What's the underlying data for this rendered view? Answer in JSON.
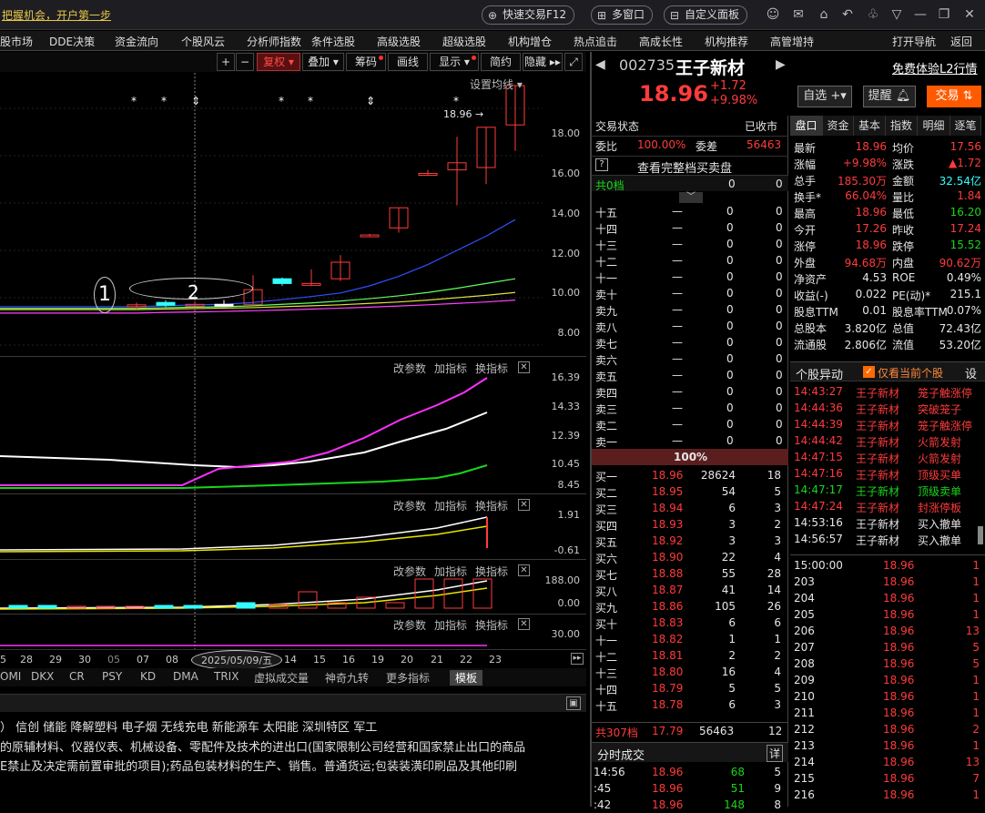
{
  "title": "把握机会，开户第一步",
  "top_buttons": [
    {
      "label": "快速交易F12",
      "icon": "quick-trade-icon"
    },
    {
      "label": "多窗口",
      "icon": "multi-window-icon"
    },
    {
      "label": "自定义面板",
      "icon": "custom-panel-icon"
    }
  ],
  "menu": [
    "股市场",
    "DDE决策",
    "资金流向",
    "个股风云",
    "分析师指数",
    "条件选股",
    "高级选股",
    "超级选股",
    "机构增仓",
    "热点追击",
    "高成长性",
    "机构推荐",
    "高管增持",
    "打开导航",
    "返回"
  ],
  "chart_toolbar": [
    "+",
    "−",
    "复权",
    "叠加",
    "筹码",
    "画线",
    "显示",
    "简约",
    "隐藏"
  ],
  "chart": {
    "setting_label": "设置均线",
    "last_price_label": "18.96",
    "y_labels": [
      "18.00",
      "16.00",
      "14.00",
      "12.00",
      "10.00",
      "8.00"
    ],
    "annotation_1": "1",
    "annotation_2": "2",
    "star_marks": [
      "*",
      "*",
      "*",
      "*",
      "*"
    ],
    "arrow_marks": [
      "⇕",
      "⇕"
    ]
  },
  "chart_data": {
    "type": "candlestick",
    "y_range": [
      7.5,
      19.5
    ],
    "candles": [
      {
        "o": 9.62,
        "c": 9.7,
        "h": 9.8,
        "l": 9.5,
        "color": "red"
      },
      {
        "o": 9.8,
        "c": 9.68,
        "h": 9.9,
        "l": 9.6,
        "color": "cyan"
      },
      {
        "o": 9.7,
        "c": 9.72,
        "h": 9.85,
        "l": 9.62,
        "color": "red"
      },
      {
        "o": 9.72,
        "c": 9.72,
        "h": 9.9,
        "l": 9.6,
        "color": "white"
      },
      {
        "o": 9.72,
        "c": 10.34,
        "h": 10.95,
        "l": 9.72,
        "color": "red"
      },
      {
        "o": 10.8,
        "c": 10.6,
        "h": 10.85,
        "l": 10.5,
        "color": "cyan"
      },
      {
        "o": 10.55,
        "c": 10.6,
        "h": 11.2,
        "l": 10.5,
        "color": "red"
      },
      {
        "o": 10.8,
        "c": 11.5,
        "h": 11.8,
        "l": 10.7,
        "color": "red"
      },
      {
        "o": 12.6,
        "c": 12.65,
        "h": 12.7,
        "l": 12.6,
        "color": "red"
      },
      {
        "o": 12.95,
        "c": 13.8,
        "h": 13.8,
        "l": 12.75,
        "color": "red"
      },
      {
        "o": 15.2,
        "c": 15.25,
        "h": 15.4,
        "l": 15.15,
        "color": "red"
      },
      {
        "o": 15.4,
        "c": 15.7,
        "h": 16.8,
        "l": 13.9,
        "color": "red"
      },
      {
        "o": 15.5,
        "c": 17.2,
        "h": 17.2,
        "l": 14.8,
        "color": "red"
      },
      {
        "o": 17.3,
        "c": 18.96,
        "h": 18.96,
        "l": 16.2,
        "color": "red"
      }
    ],
    "ma_lines": [
      {
        "name": "MA5",
        "color": "#3050ff",
        "values": [
          9.62,
          9.66,
          9.7,
          9.72,
          9.8,
          9.92,
          10.05,
          10.2,
          10.5,
          10.9,
          11.4,
          12.0,
          12.6,
          13.3
        ]
      },
      {
        "name": "MA10",
        "color": "#60ff60",
        "values": [
          9.55,
          9.58,
          9.6,
          9.62,
          9.66,
          9.72,
          9.78,
          9.86,
          9.96,
          10.08,
          10.22,
          10.4,
          10.6,
          10.8
        ]
      },
      {
        "name": "MA20",
        "color": "#e0e040",
        "values": [
          9.5,
          9.52,
          9.54,
          9.56,
          9.58,
          9.62,
          9.66,
          9.7,
          9.76,
          9.82,
          9.9,
          10.0,
          10.1,
          10.22
        ]
      },
      {
        "name": "MA60",
        "color": "#ff40ff",
        "values": [
          9.35,
          9.38,
          9.4,
          9.42,
          9.45,
          9.48,
          9.52,
          9.56,
          9.6,
          9.65,
          9.7,
          9.76,
          9.82,
          9.9
        ]
      }
    ]
  },
  "panels": [
    {
      "labels": [
        "改参数",
        "加指标",
        "换指标"
      ],
      "y_labels": [
        "16.39",
        "14.33",
        "12.39",
        "10.45",
        "8.45"
      ]
    },
    {
      "labels": [
        "改参数",
        "加指标",
        "换指标"
      ],
      "y_labels": [
        "1.91",
        "-0.61"
      ]
    },
    {
      "labels": [
        "改参数",
        "加指标",
        "换指标"
      ],
      "y_labels": [
        "188.00",
        "0.00"
      ]
    },
    {
      "labels": [
        "改参数",
        "加指标",
        "换指标"
      ],
      "y_labels": [
        "30.00"
      ]
    }
  ],
  "x_axis": [
    "5",
    "28",
    "29",
    "30",
    "05",
    "07",
    "08",
    "2025/05/09/五",
    "14",
    "15",
    "16",
    "19",
    "20",
    "21",
    "22",
    "23"
  ],
  "indicator_tabs": [
    "OMI",
    "DKX",
    "CR",
    "PSY",
    "KD",
    "DMA",
    "TRIX",
    "虚拟成交量",
    "神奇九转",
    "更多指标",
    "模板"
  ],
  "concepts": "） 信创  储能  降解塑料  电子烟  无线充电  新能源车  太阳能  深圳特区  军工",
  "desc_line1": "的原辅材料、仪器仪表、机械设备、零配件及技术的进出口(国家限制公司经营和国家禁止出口的商品",
  "desc_line2": "E禁止及决定需前置审批的项目);药品包装材料的生产、销售。普通货运;包装装潢印刷品及其他印刷",
  "stock": {
    "code": "002735",
    "name": "王子新材",
    "l2_link": "免费体验L2行情",
    "price": "18.96",
    "change": "+1.72",
    "pct": "+9.98%",
    "btn_watch": "自选",
    "btn_alert": "提醒",
    "btn_trade": "交易"
  },
  "order_book": {
    "status_label": "交易状态",
    "status_value": "已收市",
    "weibi_label": "委比",
    "weibi_value": "100.00%",
    "weicha_label": "委差",
    "weicha_value": "56463",
    "full_book": "查看完整档买卖盘",
    "total_sell_label": "共0档",
    "total_sell_vol": "0",
    "total_sell_cnt": "0",
    "sells": [
      "十五",
      "十四",
      "十三",
      "十二",
      "十一",
      "卖十",
      "卖九",
      "卖八",
      "卖七",
      "卖六",
      "卖五",
      "卖四",
      "卖三",
      "卖二",
      "卖一"
    ],
    "sell_price": "—",
    "sell_vol": "0",
    "sell_cnt": "0",
    "ratio_bar": "100%",
    "buys": [
      [
        "买一",
        "18.96",
        "28624",
        "18"
      ],
      [
        "买二",
        "18.95",
        "54",
        "5"
      ],
      [
        "买三",
        "18.94",
        "6",
        "3"
      ],
      [
        "买四",
        "18.93",
        "3",
        "2"
      ],
      [
        "买五",
        "18.92",
        "3",
        "3"
      ],
      [
        "买六",
        "18.90",
        "22",
        "4"
      ],
      [
        "买七",
        "18.88",
        "55",
        "28"
      ],
      [
        "买八",
        "18.87",
        "41",
        "14"
      ],
      [
        "买九",
        "18.86",
        "105",
        "26"
      ],
      [
        "买十",
        "18.83",
        "6",
        "6"
      ],
      [
        "十一",
        "18.82",
        "1",
        "1"
      ],
      [
        "十二",
        "18.81",
        "2",
        "2"
      ],
      [
        "十三",
        "18.80",
        "16",
        "4"
      ],
      [
        "十四",
        "18.79",
        "5",
        "5"
      ],
      [
        "十五",
        "18.78",
        "6",
        "3"
      ]
    ],
    "total_buy": [
      "共307档",
      "17.79",
      "56463",
      "12"
    ],
    "ticks_title": "分时成交",
    "ticks_btn": "详",
    "ticks": [
      [
        "14:56",
        "18.96",
        "68",
        "5"
      ],
      [
        ":45",
        "18.96",
        "51",
        "9"
      ],
      [
        ":42",
        "18.96",
        "148",
        "8"
      ]
    ]
  },
  "quote_tabs": [
    "盘口",
    "资金",
    "基本",
    "指数",
    "明细",
    "逐笔"
  ],
  "quote": [
    [
      "最新",
      "18.96",
      "均价",
      "17.56"
    ],
    [
      "涨幅",
      "+9.98%",
      "涨跌",
      "▲1.72"
    ],
    [
      "总手",
      "185.30万",
      "金额",
      "32.54亿"
    ],
    [
      "换手*",
      "66.04%",
      "量比",
      "1.84"
    ],
    [
      "最高",
      "18.96",
      "最低",
      "16.20"
    ],
    [
      "今开",
      "17.26",
      "昨收",
      "17.24"
    ],
    [
      "涨停",
      "18.96",
      "跌停",
      "15.52"
    ],
    [
      "外盘",
      "94.68万",
      "内盘",
      "90.62万"
    ],
    [
      "净资产",
      "4.53",
      "ROE",
      "0.49%"
    ],
    [
      "收益(-)",
      "0.022",
      "PE(动)*",
      "215.1"
    ],
    [
      "股息TTM",
      "0.01",
      "股息率TTM",
      "0.07%"
    ],
    [
      "总股本",
      "3.820亿",
      "总值",
      "72.43亿"
    ],
    [
      "流通股",
      "2.806亿",
      "流值",
      "53.20亿"
    ]
  ],
  "alerts_title": "个股异动",
  "alerts_check": "仅看当前个股",
  "alerts_btn": "设",
  "alerts": [
    [
      "14:43:27",
      "王子新材",
      "笼子触涨停"
    ],
    [
      "14:44:36",
      "王子新材",
      "突破笼子"
    ],
    [
      "14:44:39",
      "王子新材",
      "笼子触涨停"
    ],
    [
      "14:44:42",
      "王子新材",
      "火箭发射"
    ],
    [
      "14:47:15",
      "王子新材",
      "火箭发射"
    ],
    [
      "14:47:16",
      "王子新材",
      "顶级买单"
    ],
    [
      "14:47:17",
      "王子新材",
      "顶级卖单"
    ],
    [
      "14:47:24",
      "王子新材",
      "封涨停板"
    ],
    [
      "14:53:16",
      "王子新材",
      "买入撤单"
    ],
    [
      "14:56:57",
      "王子新材",
      "买入撤单"
    ]
  ],
  "trades": [
    [
      "15:00:00",
      "18.96",
      "1"
    ],
    [
      "203",
      "18.96",
      "1"
    ],
    [
      "204",
      "18.96",
      "1"
    ],
    [
      "205",
      "18.96",
      "1"
    ],
    [
      "206",
      "18.96",
      "13"
    ],
    [
      "207",
      "18.96",
      "5"
    ],
    [
      "208",
      "18.96",
      "5"
    ],
    [
      "209",
      "18.96",
      "1"
    ],
    [
      "210",
      "18.96",
      "1"
    ],
    [
      "211",
      "18.96",
      "1"
    ],
    [
      "212",
      "18.96",
      "2"
    ],
    [
      "213",
      "18.96",
      "1"
    ],
    [
      "214",
      "18.96",
      "13"
    ],
    [
      "215",
      "18.96",
      "7"
    ],
    [
      "216",
      "18.96",
      "1"
    ]
  ]
}
